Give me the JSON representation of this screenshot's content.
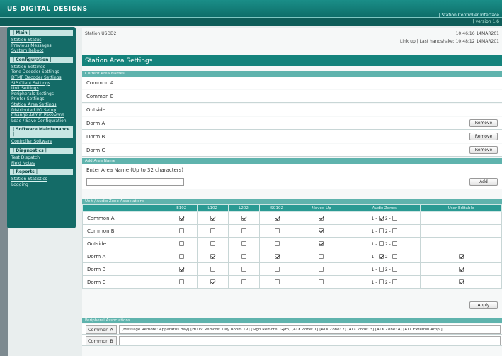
{
  "header": {
    "brand": "US DIGITAL DESIGNS",
    "title": "| Station Controller Interface",
    "version": "| version 1.6"
  },
  "sidebar": {
    "sections": [
      {
        "title": "| Main |",
        "links": [
          "Station Status",
          "Previous Messages",
          "System Reboot"
        ]
      },
      {
        "title": "| Configuration |",
        "links": [
          "Station Settings",
          "Tone Decoder Settings",
          "DTMF Decoder Settings",
          "SIP Client Settings",
          "Unit Settings",
          "Peripherals Settings",
          "Printer Settings",
          "Station Area Settings",
          "Distributed I/O Setup",
          "Change Admin Password",
          "Load / Save Configuration"
        ]
      },
      {
        "title": "| Software Maintenance |",
        "links": [
          "Controller Software"
        ]
      },
      {
        "title": "| Diagnostics |",
        "links": [
          "Test Dispatch",
          "Field Notes"
        ]
      },
      {
        "title": "| Reports |",
        "links": [
          "Station Statistics",
          "Logging"
        ]
      }
    ]
  },
  "status": {
    "station": "Station USDD2",
    "time": "10:46:16 14MAR201",
    "link": "Link up | Last handshake: 10:48:12 14MAR201"
  },
  "page_title": "Station Area Settings",
  "current_areas": {
    "heading": "Current Area Names",
    "areas": [
      {
        "name": "Common A",
        "removable": false
      },
      {
        "name": "Common B",
        "removable": false
      },
      {
        "name": "Outside",
        "removable": false
      },
      {
        "name": "Dorm A",
        "removable": true
      },
      {
        "name": "Dorm B",
        "removable": true
      },
      {
        "name": "Dorm C",
        "removable": true
      }
    ],
    "remove_label": "Remove"
  },
  "add_area": {
    "heading": "Add Area Name",
    "prompt": "Enter Area Name (Up to 32 characters)",
    "input_value": "",
    "add_label": "Add"
  },
  "associations": {
    "heading": "Unit / Audio Zone Associations",
    "columns": [
      "E102",
      "L102",
      "L202",
      "SC102",
      "Moved Up",
      "Audio Zones",
      "User Editable"
    ],
    "zone1_label": "1 -",
    "zone2_label": "2 -",
    "rows": [
      {
        "area": "Common A",
        "units": [
          true,
          true,
          true,
          true
        ],
        "moved_up": true,
        "zone1": true,
        "zone2": false,
        "editable": null
      },
      {
        "area": "Common B",
        "units": [
          false,
          false,
          false,
          false
        ],
        "moved_up": true,
        "zone1": false,
        "zone2": false,
        "editable": null
      },
      {
        "area": "Outside",
        "units": [
          false,
          false,
          false,
          false
        ],
        "moved_up": true,
        "zone1": false,
        "zone2": false,
        "editable": null
      },
      {
        "area": "Dorm A",
        "units": [
          false,
          true,
          false,
          true
        ],
        "moved_up": false,
        "zone1": true,
        "zone2": false,
        "editable": true
      },
      {
        "area": "Dorm B",
        "units": [
          true,
          false,
          false,
          false
        ],
        "moved_up": false,
        "zone1": false,
        "zone2": false,
        "editable": true
      },
      {
        "area": "Dorm C",
        "units": [
          false,
          true,
          false,
          false
        ],
        "moved_up": false,
        "zone1": false,
        "zone2": false,
        "editable": true
      }
    ],
    "apply_label": "Apply"
  },
  "peripherals": {
    "heading": "Peripheral Associations",
    "rows": [
      {
        "area": "Common A",
        "value": "[Message Remote: Apparatus Bay] [HDTV Remote: Day Room TV] [Sign Remote: Gym] [ATX Zone: 1] [ATX Zone: 2] [ATX Zone: 3] [ATX Zone: 4] [ATX External Amp.]"
      },
      {
        "area": "Common B",
        "value": ""
      }
    ]
  }
}
